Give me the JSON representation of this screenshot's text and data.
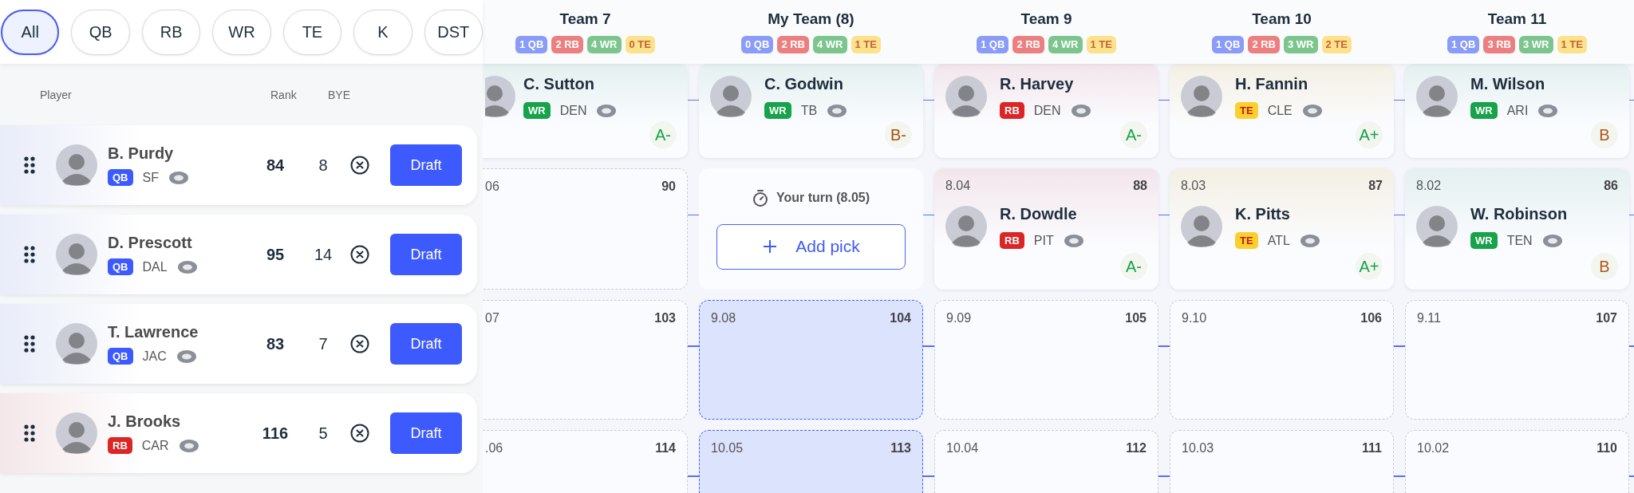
{
  "filters": [
    {
      "label": "All",
      "selected": true
    },
    {
      "label": "QB",
      "selected": false
    },
    {
      "label": "RB",
      "selected": false
    },
    {
      "label": "WR",
      "selected": false
    },
    {
      "label": "TE",
      "selected": false
    },
    {
      "label": "K",
      "selected": false
    },
    {
      "label": "DST",
      "selected": false
    }
  ],
  "player_list": {
    "columns": [
      "Player",
      "Rank",
      "BYE"
    ],
    "players": [
      {
        "name": "B. Purdy",
        "position": "QB",
        "kind": "qb",
        "team": "SF",
        "rank": "84",
        "bye": "8",
        "action": "Draft"
      },
      {
        "name": "D. Prescott",
        "position": "QB",
        "kind": "qb",
        "team": "DAL",
        "rank": "95",
        "bye": "14",
        "action": "Draft"
      },
      {
        "name": "T. Lawrence",
        "position": "QB",
        "kind": "qb",
        "team": "JAC",
        "rank": "83",
        "bye": "7",
        "action": "Draft"
      },
      {
        "name": "J. Brooks",
        "position": "RB",
        "kind": "rb",
        "team": "CAR",
        "rank": "116",
        "bye": "5",
        "action": "Draft"
      }
    ]
  },
  "board": {
    "teams": [
      {
        "name": "Team 7",
        "counts": [
          {
            "text": "1 QB",
            "kind": "qb"
          },
          {
            "text": "2 RB",
            "kind": "rb"
          },
          {
            "text": "4 WR",
            "kind": "wr"
          },
          {
            "text": "0 TE",
            "kind": "te"
          }
        ],
        "picks": [
          {
            "kind": "player",
            "player": {
              "name": "C. Sutton",
              "position": "WR",
              "kind": "wr",
              "team": "DEN"
            },
            "grade": {
              "text": "A-",
              "color": "#16a34a"
            }
          },
          {
            "kind": "empty",
            "pick": "06",
            "overall": "90"
          },
          {
            "kind": "empty",
            "pick": "07",
            "overall": "103"
          },
          {
            "kind": "empty",
            "pick": ".06",
            "overall": "114"
          }
        ]
      },
      {
        "name": "My Team (8)",
        "counts": [
          {
            "text": "0 QB",
            "kind": "qb"
          },
          {
            "text": "2 RB",
            "kind": "rb"
          },
          {
            "text": "4 WR",
            "kind": "wr"
          },
          {
            "text": "1 TE",
            "kind": "te"
          }
        ],
        "picks": [
          {
            "kind": "player",
            "player": {
              "name": "C. Godwin",
              "position": "WR",
              "kind": "wr",
              "team": "TB"
            },
            "grade": {
              "text": "B-",
              "color": "#a8500f"
            }
          },
          {
            "kind": "my_turn",
            "text": "Your turn (8.05)",
            "button": "Add pick"
          },
          {
            "kind": "upcoming",
            "pick": "9.08",
            "overall": "104"
          },
          {
            "kind": "upcoming",
            "pick": "10.05",
            "overall": "113"
          }
        ]
      },
      {
        "name": "Team 9",
        "counts": [
          {
            "text": "1 QB",
            "kind": "qb"
          },
          {
            "text": "2 RB",
            "kind": "rb"
          },
          {
            "text": "4 WR",
            "kind": "wr"
          },
          {
            "text": "1 TE",
            "kind": "te"
          }
        ],
        "picks": [
          {
            "kind": "player",
            "player": {
              "name": "R. Harvey",
              "position": "RB",
              "kind": "rb",
              "team": "DEN"
            },
            "grade": {
              "text": "A-",
              "color": "#16a34a"
            }
          },
          {
            "kind": "player",
            "pick": "8.04",
            "overall": "88",
            "player": {
              "name": "R. Dowdle",
              "position": "RB",
              "kind": "rb",
              "team": "PIT"
            },
            "grade": {
              "text": "A-",
              "color": "#16a34a"
            }
          },
          {
            "kind": "empty",
            "pick": "9.09",
            "overall": "105"
          },
          {
            "kind": "empty",
            "pick": "10.04",
            "overall": "112"
          }
        ]
      },
      {
        "name": "Team 10",
        "counts": [
          {
            "text": "1 QB",
            "kind": "qb"
          },
          {
            "text": "2 RB",
            "kind": "rb"
          },
          {
            "text": "3 WR",
            "kind": "wr"
          },
          {
            "text": "2 TE",
            "kind": "te"
          }
        ],
        "picks": [
          {
            "kind": "player",
            "player": {
              "name": "H. Fannin",
              "position": "TE",
              "kind": "te",
              "team": "CLE"
            },
            "grade": {
              "text": "A+",
              "color": "#16a34a"
            }
          },
          {
            "kind": "player",
            "pick": "8.03",
            "overall": "87",
            "player": {
              "name": "K. Pitts",
              "position": "TE",
              "kind": "te",
              "team": "ATL"
            },
            "grade": {
              "text": "A+",
              "color": "#16a34a"
            }
          },
          {
            "kind": "empty",
            "pick": "9.10",
            "overall": "106"
          },
          {
            "kind": "empty",
            "pick": "10.03",
            "overall": "111"
          }
        ]
      },
      {
        "name": "Team 11",
        "counts": [
          {
            "text": "1 QB",
            "kind": "qb"
          },
          {
            "text": "3 RB",
            "kind": "rb"
          },
          {
            "text": "3 WR",
            "kind": "wr"
          },
          {
            "text": "1 TE",
            "kind": "te"
          }
        ],
        "picks": [
          {
            "kind": "player",
            "player": {
              "name": "M. Wilson",
              "position": "WR",
              "kind": "wr",
              "team": "ARI"
            },
            "grade": {
              "text": "B",
              "color": "#b4531f"
            }
          },
          {
            "kind": "player",
            "pick": "8.02",
            "overall": "86",
            "player": {
              "name": "W. Robinson",
              "position": "WR",
              "kind": "wr",
              "team": "TEN"
            },
            "grade": {
              "text": "B",
              "color": "#b4531f"
            }
          },
          {
            "kind": "empty",
            "pick": "9.11",
            "overall": "107"
          },
          {
            "kind": "empty",
            "pick": "10.02",
            "overall": "110"
          }
        ]
      }
    ]
  }
}
